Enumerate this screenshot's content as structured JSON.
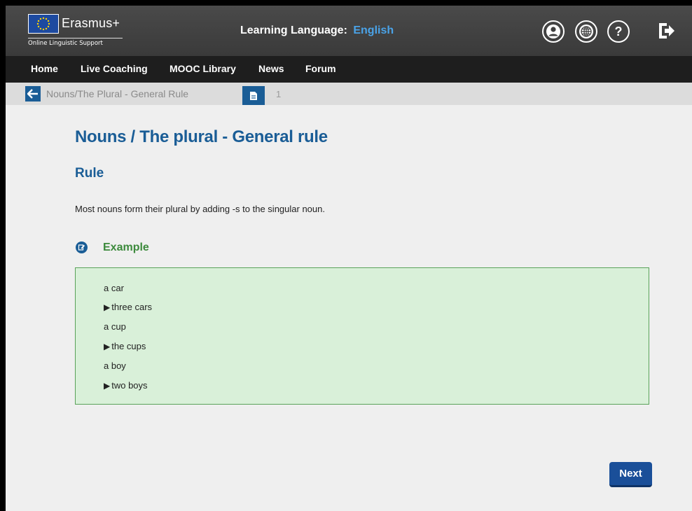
{
  "header": {
    "logo_name": "Erasmus+",
    "logo_subtitle": "Online Linguistic Support",
    "learning_language_label": "Learning Language:",
    "learning_language_value": "English",
    "icons": [
      "user-icon",
      "globe-icon",
      "help-icon",
      "logout-icon"
    ]
  },
  "nav": {
    "items": [
      "Home",
      "Live Coaching",
      "MOOC Library",
      "News",
      "Forum"
    ]
  },
  "breadcrumb": {
    "text": "Nouns/The Plural - General Rule",
    "page_number": "1"
  },
  "content": {
    "title": "Nouns / The plural - General rule",
    "subtitle": "Rule",
    "rule_text": "Most nouns form their plural by adding -s to the singular noun.",
    "example_label": "Example",
    "examples": [
      {
        "text": "a car",
        "arrow": false
      },
      {
        "text": "three cars",
        "arrow": true
      },
      {
        "text": "a cup",
        "arrow": false
      },
      {
        "text": "the cups",
        "arrow": true
      },
      {
        "text": "a boy",
        "arrow": false
      },
      {
        "text": "two boys",
        "arrow": true
      }
    ],
    "next_label": "Next"
  },
  "colors": {
    "accent": "#1a5d96",
    "example_green": "#3c8a3c",
    "example_bg": "#d9f0d9"
  }
}
